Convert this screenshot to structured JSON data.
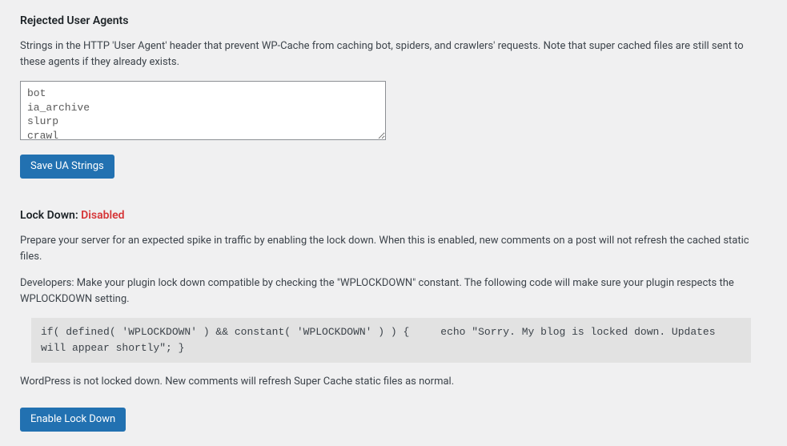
{
  "rejected_ua": {
    "heading": "Rejected User Agents",
    "description": "Strings in the HTTP 'User Agent' header that prevent WP-Cache from caching bot, spiders, and crawlers' requests. Note that super cached files are still sent to these agents if they already exists.",
    "textarea_value": "bot\nia_archive\nslurp\ncrawl",
    "save_button": "Save UA Strings"
  },
  "lockdown": {
    "heading_prefix": "Lock Down: ",
    "status": "Disabled",
    "para1": "Prepare your server for an expected spike in traffic by enabling the lock down. When this is enabled, new comments on a post will not refresh the cached static files.",
    "para2": "Developers: Make your plugin lock down compatible by checking the \"WPLOCKDOWN\" constant. The following code will make sure your plugin respects the WPLOCKDOWN setting.",
    "code": "if( defined( 'WPLOCKDOWN' ) && constant( 'WPLOCKDOWN' ) ) {     echo \"Sorry. My blog is locked down. Updates will appear shortly\"; }",
    "para3": "WordPress is not locked down. New comments will refresh Super Cache static files as normal.",
    "enable_button": "Enable Lock Down"
  }
}
